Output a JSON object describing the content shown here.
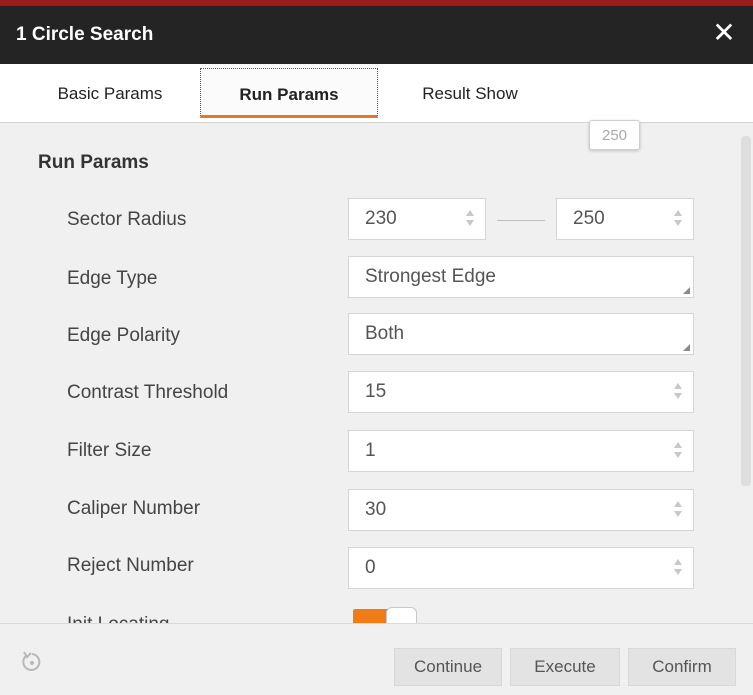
{
  "window": {
    "title": "1 Circle Search"
  },
  "tabs": [
    {
      "label": "Basic Params"
    },
    {
      "label": "Run Params"
    },
    {
      "label": "Result Show"
    }
  ],
  "section": {
    "title": "Run Params"
  },
  "params": {
    "sector_radius": {
      "label": "Sector Radius",
      "min": "230",
      "max": "250",
      "tooltip": "250"
    },
    "edge_type": {
      "label": "Edge Type",
      "value": "Strongest Edge"
    },
    "edge_polarity": {
      "label": "Edge Polarity",
      "value": "Both"
    },
    "contrast_threshold": {
      "label": "Contrast Threshold",
      "value": "15"
    },
    "filter_size": {
      "label": "Filter Size",
      "value": "1"
    },
    "caliper_number": {
      "label": "Caliper Number",
      "value": "30"
    },
    "reject_number": {
      "label": "Reject Number",
      "value": "0"
    },
    "init_locating": {
      "label": "Init Locating",
      "enabled": true
    }
  },
  "footer": {
    "continue_label": "Continue",
    "execute_label": "Execute",
    "confirm_label": "Confirm"
  },
  "colors": {
    "title_bar": "#242424",
    "accent": "#f07c17",
    "top_line": "#9b1b1b"
  },
  "icons": {
    "close": "close-icon",
    "reset": "reset-icon",
    "spinner_up": "chevron-up-icon",
    "spinner_down": "chevron-down-icon"
  }
}
